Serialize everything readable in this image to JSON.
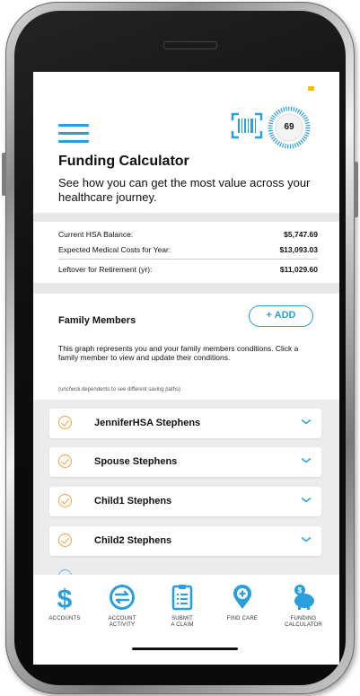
{
  "header": {
    "score": "69",
    "title": "Funding Calculator",
    "subtitle": "See how you can get the most value across your healthcare journey."
  },
  "summary": [
    {
      "label": "Current HSA Balance:",
      "value": "$5,747.69"
    },
    {
      "label": "Expected Medical Costs for Year:",
      "value": "$13,093.03"
    },
    {
      "label": "Leftover for Retirement (yr):",
      "value": "$11,029.60"
    }
  ],
  "family": {
    "title": "Family Members",
    "add_label": "+ ADD",
    "description": "This graph represents you and your family members conditions. Click a family member to view and update their conditions.",
    "note": "(uncheck dependents to see different saving paths)",
    "members": [
      {
        "name": "JenniferHSA Stephens",
        "checked": true
      },
      {
        "name": "Spouse Stephens",
        "checked": true
      },
      {
        "name": "Child1 Stephens",
        "checked": true
      },
      {
        "name": "Child2 Stephens",
        "checked": true
      }
    ]
  },
  "nav": [
    {
      "label_line1": "ACCOUNTS",
      "label_line2": "",
      "icon": "dollar-icon"
    },
    {
      "label_line1": "ACCOUNT",
      "label_line2": "ACTIVITY",
      "icon": "transfer-icon"
    },
    {
      "label_line1": "SUBMIT",
      "label_line2": "A CLAIM",
      "icon": "clipboard-icon"
    },
    {
      "label_line1": "FIND CARE",
      "label_line2": "",
      "icon": "location-plus-icon"
    },
    {
      "label_line1": "FUNDING",
      "label_line2": "CALCULATOR",
      "icon": "piggy-bank-icon"
    }
  ],
  "colors": {
    "accent": "#2a9fe0",
    "check": "#f2a33a",
    "status": "#f2c200"
  }
}
